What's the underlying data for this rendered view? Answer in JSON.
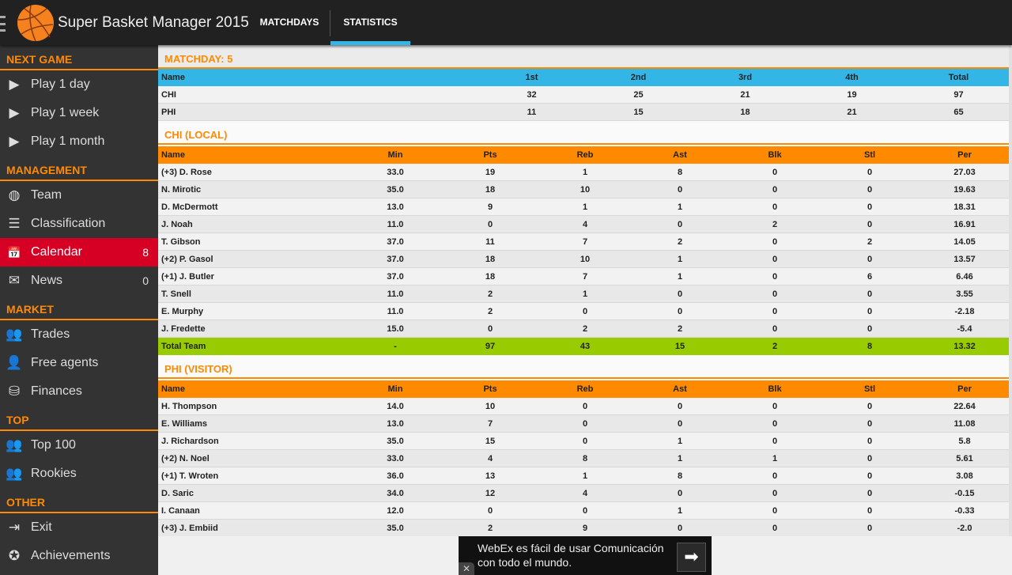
{
  "app": {
    "title": "Super Basket Manager 2015"
  },
  "tabs": [
    {
      "label": "MATCHDAYS"
    },
    {
      "label": "STATISTICS",
      "active": true
    }
  ],
  "colors": {
    "accent": "#ff8a00",
    "tab_indicator": "#33b5e5",
    "active_item": "#d50023",
    "total_row": "#99cc00",
    "score_header": "#33b5e5"
  },
  "sidebar": {
    "sections": [
      {
        "title": "NEXT GAME",
        "items": [
          {
            "label": "Play 1 day",
            "icon": "play-icon"
          },
          {
            "label": "Play 1 week",
            "icon": "play-icon"
          },
          {
            "label": "Play 1 month",
            "icon": "play-icon"
          }
        ]
      },
      {
        "title": "MANAGEMENT",
        "items": [
          {
            "label": "Team",
            "icon": "basketball-icon"
          },
          {
            "label": "Classification",
            "icon": "list-icon"
          },
          {
            "label": "Calendar",
            "icon": "calendar-icon",
            "count": "8",
            "active": true
          },
          {
            "label": "News",
            "icon": "envelope-icon",
            "count": "0"
          }
        ]
      },
      {
        "title": "MARKET",
        "items": [
          {
            "label": "Trades",
            "icon": "users-icon"
          },
          {
            "label": "Free agents",
            "icon": "add-user-icon"
          },
          {
            "label": "Finances",
            "icon": "coins-icon"
          }
        ]
      },
      {
        "title": "TOP",
        "items": [
          {
            "label": "Top 100",
            "icon": "group-icon"
          },
          {
            "label": "Rookies",
            "icon": "group-icon"
          }
        ]
      },
      {
        "title": "OTHER",
        "items": [
          {
            "label": "Exit",
            "icon": "exit-icon"
          },
          {
            "label": "Achievements",
            "icon": "star-icon"
          }
        ]
      }
    ]
  },
  "matchday": {
    "title": "MATCHDAY: 5",
    "headers": [
      "Name",
      "1st",
      "2nd",
      "3rd",
      "4th",
      "Total"
    ],
    "rows": [
      [
        "CHI",
        "32",
        "25",
        "21",
        "19",
        "97"
      ],
      [
        "PHI",
        "11",
        "15",
        "18",
        "21",
        "65"
      ]
    ]
  },
  "local": {
    "title": "CHI (LOCAL)",
    "headers": [
      "Name",
      "Min",
      "Pts",
      "Reb",
      "Ast",
      "Blk",
      "Stl",
      "Per"
    ],
    "rows": [
      [
        "(+3) D. Rose",
        "33.0",
        "19",
        "1",
        "8",
        "0",
        "0",
        "27.03"
      ],
      [
        "N. Mirotic",
        "35.0",
        "18",
        "10",
        "0",
        "0",
        "0",
        "19.63"
      ],
      [
        "D. McDermott",
        "13.0",
        "9",
        "1",
        "1",
        "0",
        "0",
        "18.31"
      ],
      [
        "J. Noah",
        "11.0",
        "0",
        "4",
        "0",
        "2",
        "0",
        "16.91"
      ],
      [
        "T. Gibson",
        "37.0",
        "11",
        "7",
        "2",
        "0",
        "2",
        "14.05"
      ],
      [
        "(+2) P. Gasol",
        "37.0",
        "18",
        "10",
        "1",
        "0",
        "0",
        "13.57"
      ],
      [
        "(+1) J. Butler",
        "37.0",
        "18",
        "7",
        "1",
        "0",
        "6",
        "6.46"
      ],
      [
        "T. Snell",
        "11.0",
        "2",
        "1",
        "0",
        "0",
        "0",
        "3.55"
      ],
      [
        "E. Murphy",
        "11.0",
        "2",
        "0",
        "0",
        "0",
        "0",
        "-2.18"
      ],
      [
        "J. Fredette",
        "15.0",
        "0",
        "2",
        "2",
        "0",
        "0",
        "-5.4"
      ]
    ],
    "total": [
      "Total Team",
      "-",
      "97",
      "43",
      "15",
      "2",
      "8",
      "13.32"
    ]
  },
  "visitor": {
    "title": "PHI (VISITOR)",
    "headers": [
      "Name",
      "Min",
      "Pts",
      "Reb",
      "Ast",
      "Blk",
      "Stl",
      "Per"
    ],
    "rows": [
      [
        "H. Thompson",
        "14.0",
        "10",
        "0",
        "0",
        "0",
        "0",
        "22.64"
      ],
      [
        "E. Williams",
        "13.0",
        "7",
        "0",
        "0",
        "0",
        "0",
        "11.08"
      ],
      [
        "J. Richardson",
        "35.0",
        "15",
        "0",
        "1",
        "0",
        "0",
        "5.8"
      ],
      [
        "(+2) N. Noel",
        "33.0",
        "4",
        "8",
        "1",
        "1",
        "0",
        "5.61"
      ],
      [
        "(+1) T. Wroten",
        "36.0",
        "13",
        "1",
        "8",
        "0",
        "0",
        "3.08"
      ],
      [
        "D. Saric",
        "34.0",
        "12",
        "4",
        "0",
        "0",
        "0",
        "-0.15"
      ],
      [
        "I. Canaan",
        "12.0",
        "0",
        "0",
        "1",
        "0",
        "0",
        "-0.33"
      ],
      [
        "(+3) J. Embiid",
        "35.0",
        "2",
        "9",
        "0",
        "0",
        "0",
        "-2.0"
      ]
    ]
  },
  "ad": {
    "text": "WebEx es fácil de usar Comunicación con todo el mundo.",
    "close": "✕",
    "arrow": "➡"
  }
}
